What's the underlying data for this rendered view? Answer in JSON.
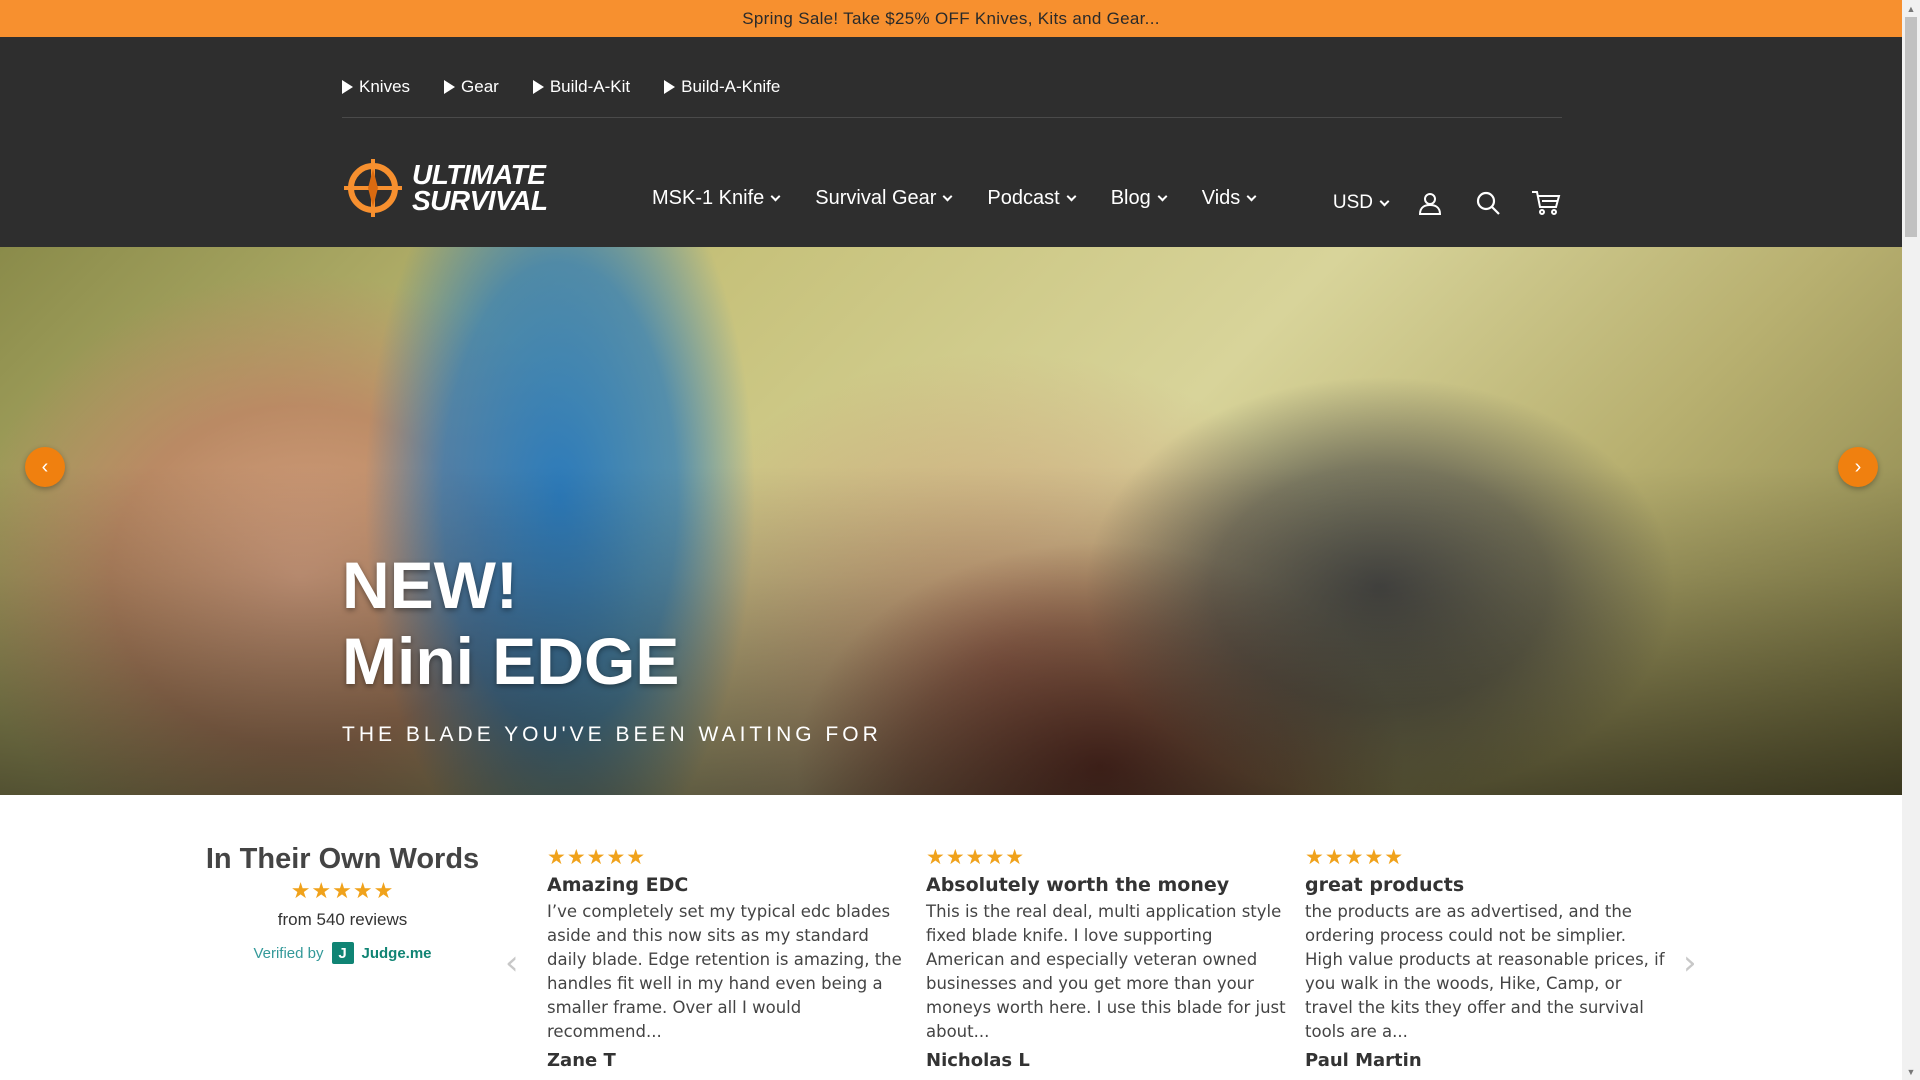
{
  "announcement": "Spring Sale! Take $25% OFF Knives, Kits and Gear...",
  "topnav": [
    "Knives",
    "Gear",
    "Build-A-Kit",
    "Build-A-Knife"
  ],
  "logo": {
    "line1": "ULTIMATE",
    "line2": "SURVIVAL"
  },
  "mainnav": [
    "MSK-1 Knife",
    "Survival Gear",
    "Podcast",
    "Blog",
    "Vids"
  ],
  "utils": {
    "currency": "USD",
    "icons": [
      "account-icon",
      "search-icon",
      "cart-icon"
    ]
  },
  "hero": {
    "title_line1": "NEW!",
    "title_line2": "Mini EDGE",
    "subtitle": "THE BLADE YOU'VE BEEN WAITING FOR",
    "prev": "‹",
    "next": "›"
  },
  "reviews_summary": {
    "title": "In Their Own Words",
    "stars": "★★★★★",
    "count": "from 540 reviews",
    "verified_by": "Verified by",
    "badge_letter": "J",
    "provider": "Judge.me"
  },
  "reviews": [
    {
      "stars": "★★★★★",
      "title": "Amazing EDC",
      "body": "I’ve completely set my typical edc blades aside and this now sits as my standard daily blade. Edge retention is amazing, the handles fit well in my hand even being a smaller frame. Over all I would recommend...",
      "author": "Zane T"
    },
    {
      "stars": "★★★★★",
      "title": "Absolutely worth the money",
      "body": "This is the real deal, multi application style fixed blade knife. I love supporting American and especially veteran owned businesses and you get more than your moneys worth here. I use this blade for just about...",
      "author": "Nicholas L"
    },
    {
      "stars": "★★★★★",
      "title": "great products",
      "body": "the products are as advertised, and the ordering process could not be simplier. High value products at reasonable prices, if you walk in the woods, Hike, Camp, or travel the kits they offer and the survival tools are a...",
      "author": "Paul Martin"
    }
  ],
  "review_arrows": {
    "prev": "‹",
    "next": "›"
  },
  "colors": {
    "accent": "#f7902f",
    "header_bg": "#2e2e2e",
    "star": "#f0a21b",
    "judgeme": "#108474"
  }
}
